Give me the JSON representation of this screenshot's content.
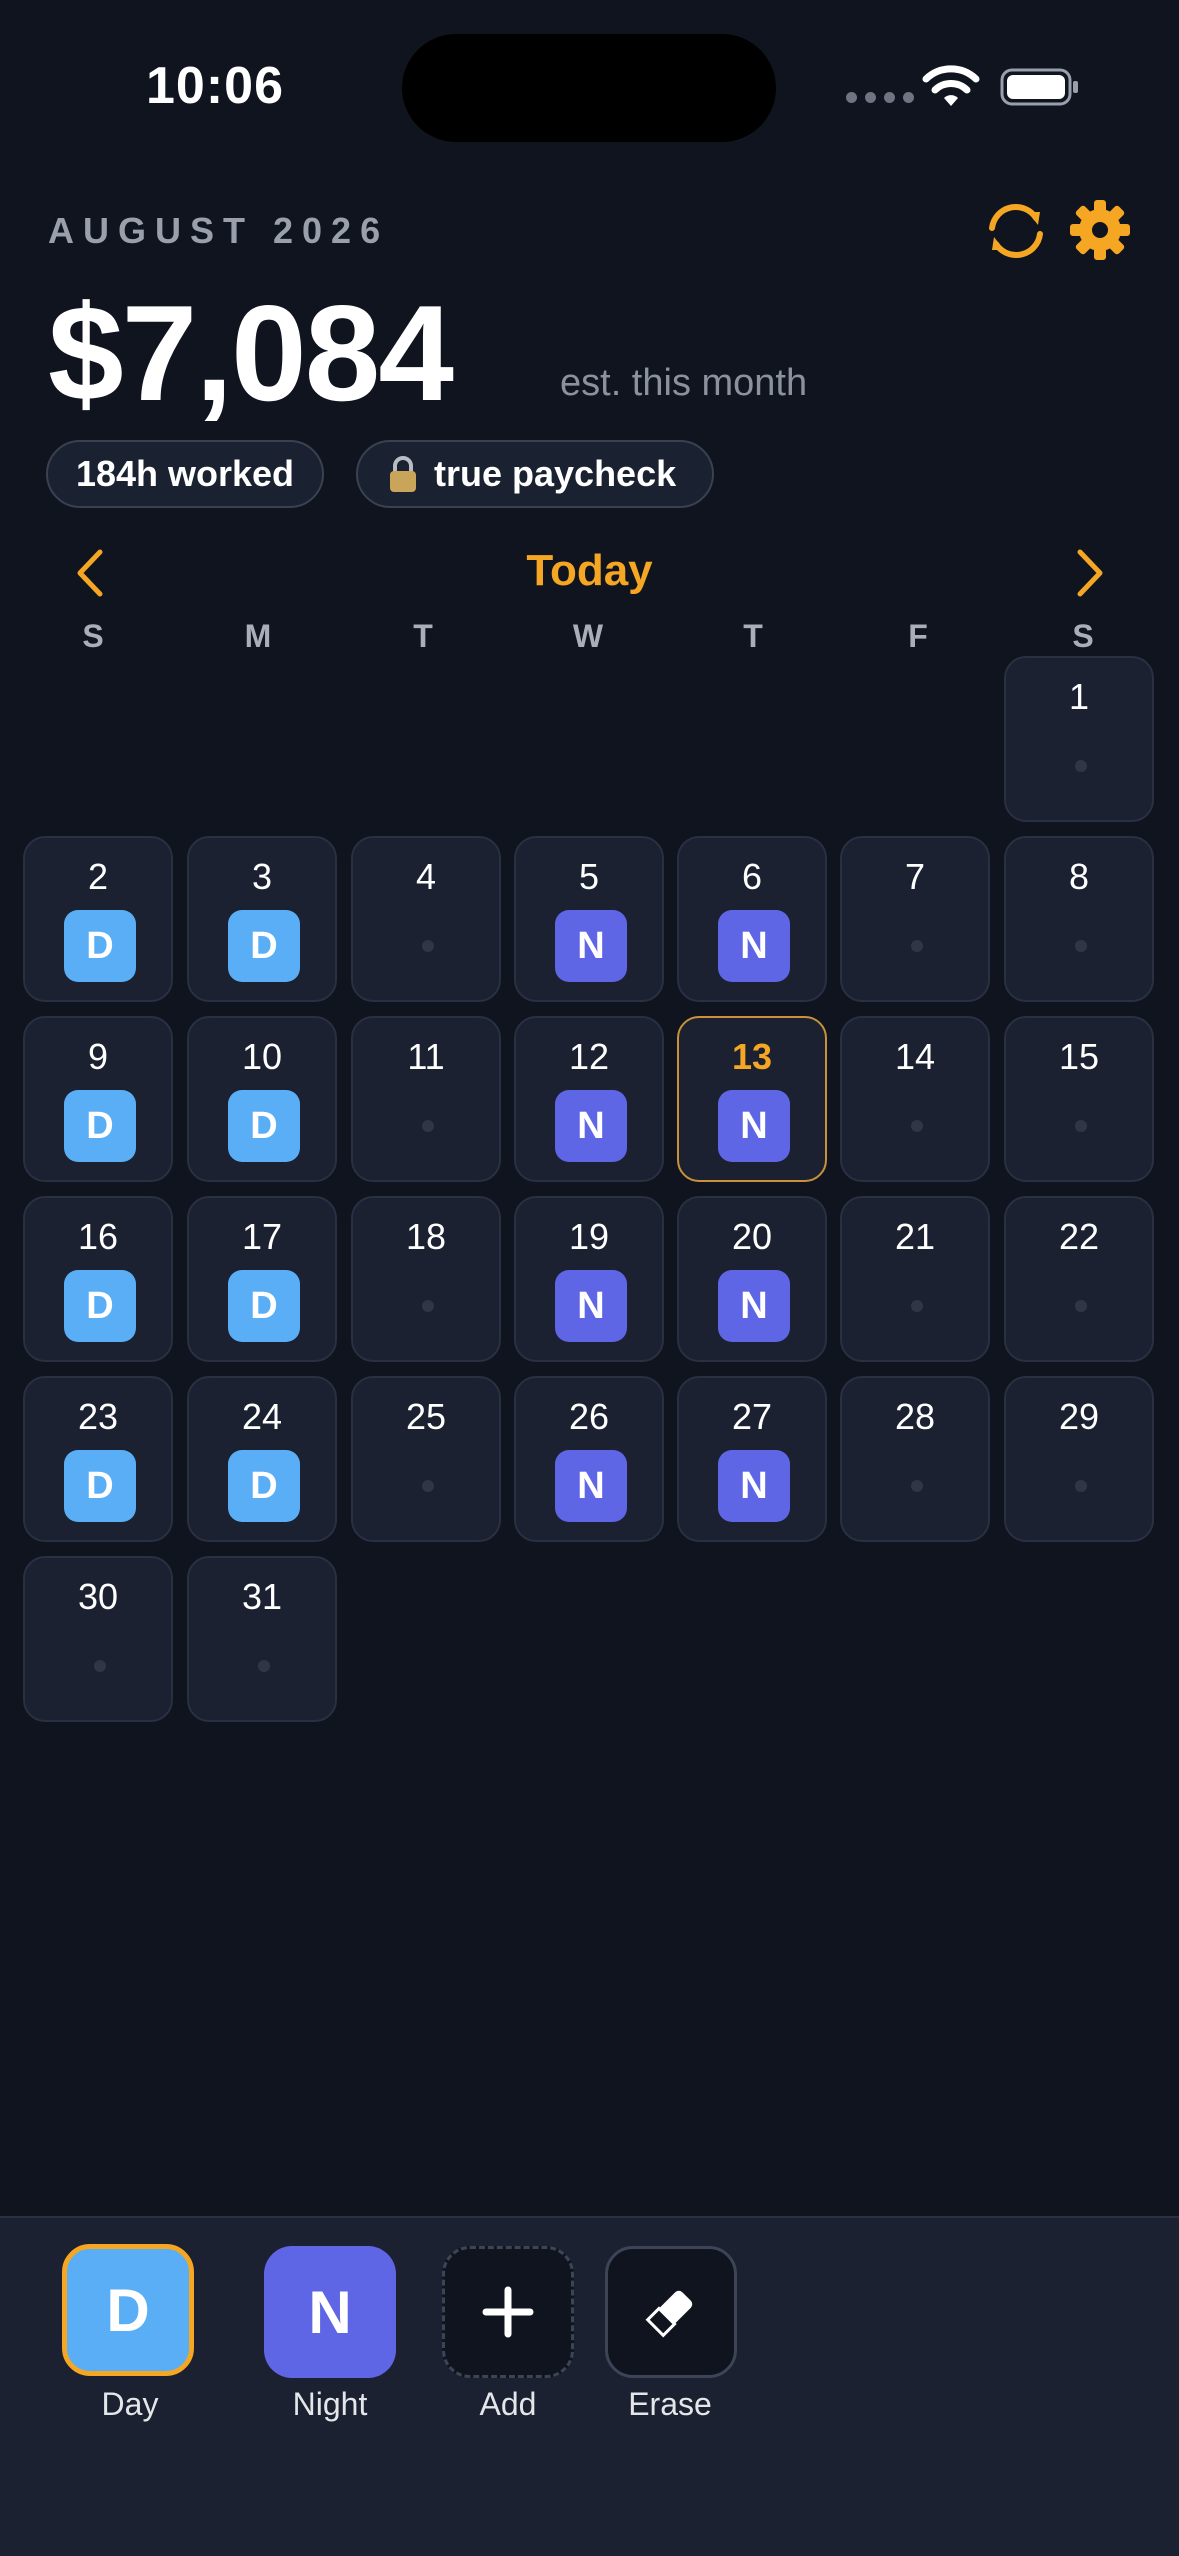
{
  "status_bar": {
    "time": "10:06"
  },
  "header": {
    "month": "AUGUST 2026",
    "amount": "$7,084",
    "amount_note": "est. this month",
    "hours_pill": "184h worked",
    "paycheck_pill": "true paycheck"
  },
  "nav": {
    "today_label": "Today"
  },
  "weekdays": [
    "S",
    "M",
    "T",
    "W",
    "T",
    "F",
    "S"
  ],
  "calendar": {
    "days": [
      {
        "n": "1",
        "shift": ""
      },
      {
        "n": "2",
        "shift": "D"
      },
      {
        "n": "3",
        "shift": "D"
      },
      {
        "n": "4",
        "shift": ""
      },
      {
        "n": "5",
        "shift": "N"
      },
      {
        "n": "6",
        "shift": "N"
      },
      {
        "n": "7",
        "shift": ""
      },
      {
        "n": "8",
        "shift": ""
      },
      {
        "n": "9",
        "shift": "D"
      },
      {
        "n": "10",
        "shift": "D"
      },
      {
        "n": "11",
        "shift": ""
      },
      {
        "n": "12",
        "shift": "N"
      },
      {
        "n": "13",
        "shift": "N",
        "today": true
      },
      {
        "n": "14",
        "shift": ""
      },
      {
        "n": "15",
        "shift": ""
      },
      {
        "n": "16",
        "shift": "D"
      },
      {
        "n": "17",
        "shift": "D"
      },
      {
        "n": "18",
        "shift": ""
      },
      {
        "n": "19",
        "shift": "N"
      },
      {
        "n": "20",
        "shift": "N"
      },
      {
        "n": "21",
        "shift": ""
      },
      {
        "n": "22",
        "shift": ""
      },
      {
        "n": "23",
        "shift": "D"
      },
      {
        "n": "24",
        "shift": "D"
      },
      {
        "n": "25",
        "shift": ""
      },
      {
        "n": "26",
        "shift": "N"
      },
      {
        "n": "27",
        "shift": "N"
      },
      {
        "n": "28",
        "shift": ""
      },
      {
        "n": "29",
        "shift": ""
      },
      {
        "n": "30",
        "shift": ""
      },
      {
        "n": "31",
        "shift": ""
      }
    ]
  },
  "palette": {
    "day": {
      "glyph": "D",
      "label": "Day"
    },
    "night": {
      "glyph": "N",
      "label": "Night"
    },
    "add": {
      "label": "Add"
    },
    "erase": {
      "label": "Erase"
    }
  },
  "colors": {
    "accent": "#f5a623",
    "day_shift": "#5aaef5",
    "night_shift": "#5f66e6",
    "background": "#0f141f",
    "cell": "#1b2130"
  },
  "icons": {
    "sync": "sync-icon",
    "settings": "gear-icon",
    "prev": "chevron-left-icon",
    "next": "chevron-right-icon",
    "lock": "lock-icon",
    "add": "plus-icon",
    "erase": "eraser-icon"
  }
}
